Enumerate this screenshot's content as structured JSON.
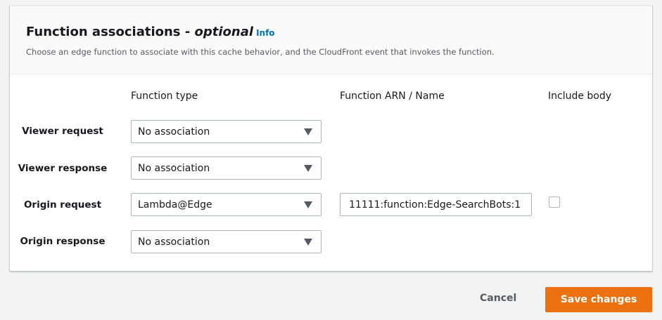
{
  "header": {
    "title": "Function associations - ",
    "title_optional": "optional",
    "info": "Info",
    "description": "Choose an edge function to associate with this cache behavior, and the CloudFront event that invokes the function."
  },
  "columns": {
    "type": "Function type",
    "arn": "Function ARN / Name",
    "body": "Include body"
  },
  "rows": [
    {
      "label": "Viewer request",
      "type": "No association"
    },
    {
      "label": "Viewer response",
      "type": "No association"
    },
    {
      "label": "Origin request",
      "type": "Lambda@Edge",
      "arn": "11111:function:Edge-SearchBots:1",
      "include_body": false
    },
    {
      "label": "Origin response",
      "type": "No association"
    }
  ],
  "actions": {
    "cancel": "Cancel",
    "save": "Save changes"
  },
  "colors": {
    "accent": "#ec7211",
    "link": "#0073bb"
  }
}
